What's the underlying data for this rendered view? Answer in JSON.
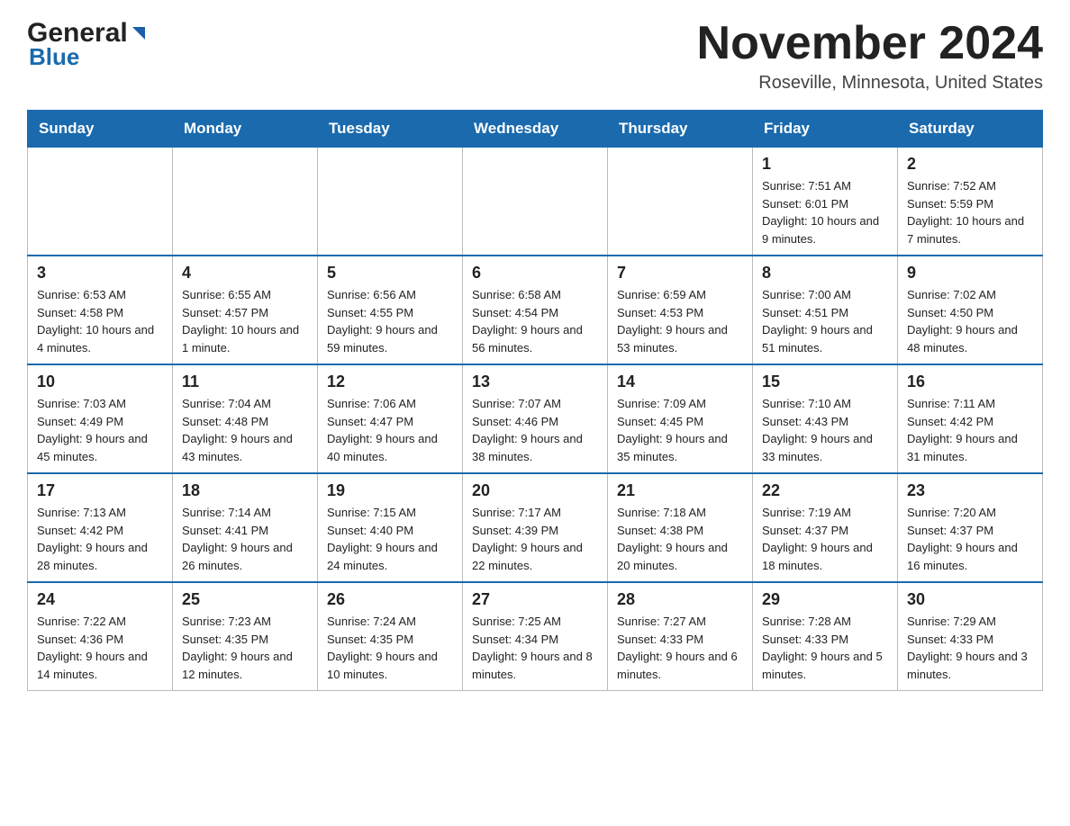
{
  "header": {
    "logo_general": "General",
    "logo_blue": "Blue",
    "title": "November 2024",
    "subtitle": "Roseville, Minnesota, United States"
  },
  "weekdays": [
    "Sunday",
    "Monday",
    "Tuesday",
    "Wednesday",
    "Thursday",
    "Friday",
    "Saturday"
  ],
  "weeks": [
    [
      {
        "day": "",
        "info": ""
      },
      {
        "day": "",
        "info": ""
      },
      {
        "day": "",
        "info": ""
      },
      {
        "day": "",
        "info": ""
      },
      {
        "day": "",
        "info": ""
      },
      {
        "day": "1",
        "info": "Sunrise: 7:51 AM\nSunset: 6:01 PM\nDaylight: 10 hours and 9 minutes."
      },
      {
        "day": "2",
        "info": "Sunrise: 7:52 AM\nSunset: 5:59 PM\nDaylight: 10 hours and 7 minutes."
      }
    ],
    [
      {
        "day": "3",
        "info": "Sunrise: 6:53 AM\nSunset: 4:58 PM\nDaylight: 10 hours and 4 minutes."
      },
      {
        "day": "4",
        "info": "Sunrise: 6:55 AM\nSunset: 4:57 PM\nDaylight: 10 hours and 1 minute."
      },
      {
        "day": "5",
        "info": "Sunrise: 6:56 AM\nSunset: 4:55 PM\nDaylight: 9 hours and 59 minutes."
      },
      {
        "day": "6",
        "info": "Sunrise: 6:58 AM\nSunset: 4:54 PM\nDaylight: 9 hours and 56 minutes."
      },
      {
        "day": "7",
        "info": "Sunrise: 6:59 AM\nSunset: 4:53 PM\nDaylight: 9 hours and 53 minutes."
      },
      {
        "day": "8",
        "info": "Sunrise: 7:00 AM\nSunset: 4:51 PM\nDaylight: 9 hours and 51 minutes."
      },
      {
        "day": "9",
        "info": "Sunrise: 7:02 AM\nSunset: 4:50 PM\nDaylight: 9 hours and 48 minutes."
      }
    ],
    [
      {
        "day": "10",
        "info": "Sunrise: 7:03 AM\nSunset: 4:49 PM\nDaylight: 9 hours and 45 minutes."
      },
      {
        "day": "11",
        "info": "Sunrise: 7:04 AM\nSunset: 4:48 PM\nDaylight: 9 hours and 43 minutes."
      },
      {
        "day": "12",
        "info": "Sunrise: 7:06 AM\nSunset: 4:47 PM\nDaylight: 9 hours and 40 minutes."
      },
      {
        "day": "13",
        "info": "Sunrise: 7:07 AM\nSunset: 4:46 PM\nDaylight: 9 hours and 38 minutes."
      },
      {
        "day": "14",
        "info": "Sunrise: 7:09 AM\nSunset: 4:45 PM\nDaylight: 9 hours and 35 minutes."
      },
      {
        "day": "15",
        "info": "Sunrise: 7:10 AM\nSunset: 4:43 PM\nDaylight: 9 hours and 33 minutes."
      },
      {
        "day": "16",
        "info": "Sunrise: 7:11 AM\nSunset: 4:42 PM\nDaylight: 9 hours and 31 minutes."
      }
    ],
    [
      {
        "day": "17",
        "info": "Sunrise: 7:13 AM\nSunset: 4:42 PM\nDaylight: 9 hours and 28 minutes."
      },
      {
        "day": "18",
        "info": "Sunrise: 7:14 AM\nSunset: 4:41 PM\nDaylight: 9 hours and 26 minutes."
      },
      {
        "day": "19",
        "info": "Sunrise: 7:15 AM\nSunset: 4:40 PM\nDaylight: 9 hours and 24 minutes."
      },
      {
        "day": "20",
        "info": "Sunrise: 7:17 AM\nSunset: 4:39 PM\nDaylight: 9 hours and 22 minutes."
      },
      {
        "day": "21",
        "info": "Sunrise: 7:18 AM\nSunset: 4:38 PM\nDaylight: 9 hours and 20 minutes."
      },
      {
        "day": "22",
        "info": "Sunrise: 7:19 AM\nSunset: 4:37 PM\nDaylight: 9 hours and 18 minutes."
      },
      {
        "day": "23",
        "info": "Sunrise: 7:20 AM\nSunset: 4:37 PM\nDaylight: 9 hours and 16 minutes."
      }
    ],
    [
      {
        "day": "24",
        "info": "Sunrise: 7:22 AM\nSunset: 4:36 PM\nDaylight: 9 hours and 14 minutes."
      },
      {
        "day": "25",
        "info": "Sunrise: 7:23 AM\nSunset: 4:35 PM\nDaylight: 9 hours and 12 minutes."
      },
      {
        "day": "26",
        "info": "Sunrise: 7:24 AM\nSunset: 4:35 PM\nDaylight: 9 hours and 10 minutes."
      },
      {
        "day": "27",
        "info": "Sunrise: 7:25 AM\nSunset: 4:34 PM\nDaylight: 9 hours and 8 minutes."
      },
      {
        "day": "28",
        "info": "Sunrise: 7:27 AM\nSunset: 4:33 PM\nDaylight: 9 hours and 6 minutes."
      },
      {
        "day": "29",
        "info": "Sunrise: 7:28 AM\nSunset: 4:33 PM\nDaylight: 9 hours and 5 minutes."
      },
      {
        "day": "30",
        "info": "Sunrise: 7:29 AM\nSunset: 4:33 PM\nDaylight: 9 hours and 3 minutes."
      }
    ]
  ]
}
